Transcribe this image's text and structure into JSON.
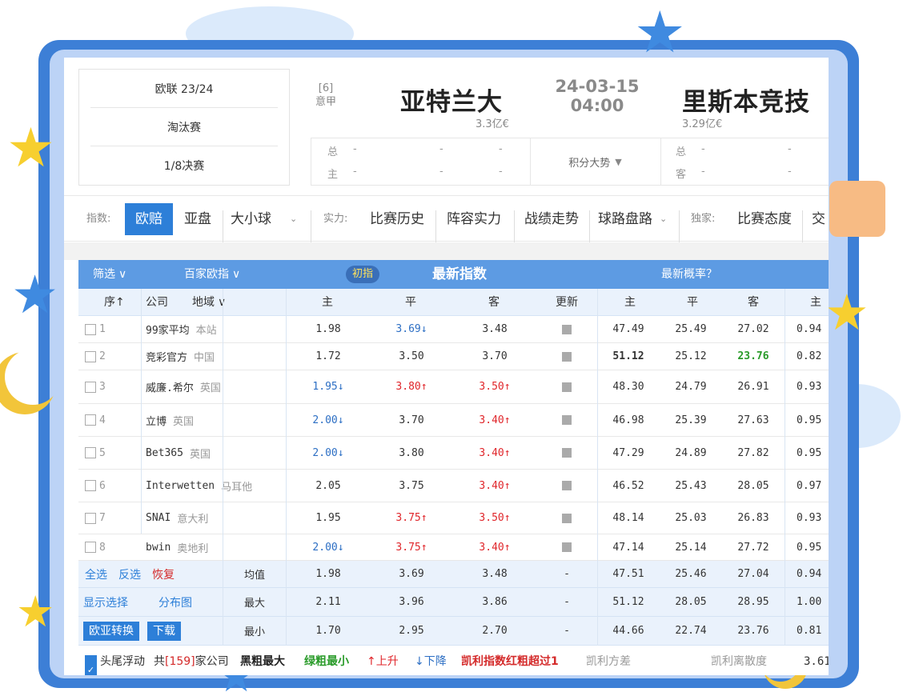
{
  "league": {
    "competition": "欧联 23/24",
    "stage": "淘汰赛",
    "round": "1/8决赛"
  },
  "match": {
    "home": {
      "rank": "[6]",
      "league": "意甲",
      "name": "亚特兰大",
      "value": "3.3亿€"
    },
    "away": {
      "name": "里斯本竞技",
      "value": "3.29亿€"
    },
    "date": "24-03-15",
    "time": "04:00",
    "home_stats": {
      "total_label": "总",
      "home_label": "主",
      "placeholder": "-"
    },
    "away_stats": {
      "total_label": "总",
      "away_label": "客",
      "placeholder": "-"
    },
    "standings_label": "积分大势"
  },
  "tabs": {
    "index_label": "指数:",
    "index_tabs": [
      "欧赔",
      "亚盘",
      "大小球"
    ],
    "strength_label": "实力:",
    "strength_tabs": [
      "比赛历史",
      "阵容实力",
      "战绩走势",
      "球路盘路"
    ],
    "exclusive_label": "独家:",
    "exclusive_tabs": [
      "比赛态度",
      "交"
    ]
  },
  "table": {
    "header": {
      "filter": "筛选",
      "baijia": "百家欧指",
      "initial_badge": "初指",
      "latest_index": "最新指数",
      "latest_prob": "最新概率？"
    },
    "columns": {
      "seq": "序",
      "company": "公司",
      "region": "地域",
      "home": "主",
      "draw": "平",
      "away": "客",
      "update": "更新",
      "p_home": "主",
      "p_draw": "平",
      "p_away": "客",
      "k_home": "主"
    },
    "rows": [
      {
        "idx": "1",
        "company": "99家平均",
        "region": "本站",
        "h": "1.98",
        "d": "3.69↓",
        "a": "3.48",
        "ph": "47.49",
        "pd": "25.49",
        "pa": "27.02",
        "k": "0.94"
      },
      {
        "idx": "2",
        "company": "竞彩官方",
        "region": "中国",
        "h": "1.72",
        "d": "3.50",
        "a": "3.70",
        "ph": "51.12",
        "pd": "25.12",
        "pa": "23.76",
        "k": "0.82"
      },
      {
        "idx": "3",
        "company": "威廉.希尔",
        "region": "英国",
        "h": "1.95↓",
        "d": "3.80↑",
        "a": "3.50↑",
        "ph": "48.30",
        "pd": "24.79",
        "pa": "26.91",
        "k": "0.93"
      },
      {
        "idx": "4",
        "company": "立博",
        "region": "英国",
        "h": "2.00↓",
        "d": "3.70",
        "a": "3.40↑",
        "ph": "46.98",
        "pd": "25.39",
        "pa": "27.63",
        "k": "0.95"
      },
      {
        "idx": "5",
        "company": "Bet365",
        "region": "英国",
        "h": "2.00↓",
        "d": "3.80",
        "a": "3.40↑",
        "ph": "47.29",
        "pd": "24.89",
        "pa": "27.82",
        "k": "0.95"
      },
      {
        "idx": "6",
        "company": "Interwetten",
        "region": "马耳他",
        "h": "2.05",
        "d": "3.75",
        "a": "3.40↑",
        "ph": "46.52",
        "pd": "25.43",
        "pa": "28.05",
        "k": "0.97"
      },
      {
        "idx": "7",
        "company": "SNAI",
        "region": "意大利",
        "h": "1.95",
        "d": "3.75↑",
        "a": "3.50↑",
        "ph": "48.14",
        "pd": "25.03",
        "pa": "26.83",
        "k": "0.93"
      },
      {
        "idx": "8",
        "company": "bwin",
        "region": "奥地利",
        "h": "2.00↓",
        "d": "3.75↑",
        "a": "3.40↑",
        "ph": "47.14",
        "pd": "25.14",
        "pa": "27.72",
        "k": "0.95"
      }
    ],
    "summary": {
      "select_all": "全选",
      "invert": "反选",
      "restore": "恢复",
      "show_selected": "显示选择",
      "distribution": "分布图",
      "convert_btn": "欧亚转换",
      "download_btn": "下载",
      "avg": {
        "label": "均值",
        "h": "1.98",
        "d": "3.69",
        "a": "3.48",
        "u": "-",
        "ph": "47.51",
        "pd": "25.46",
        "pa": "27.04",
        "k": "0.94"
      },
      "max": {
        "label": "最大",
        "h": "2.11",
        "d": "3.96",
        "a": "3.86",
        "u": "-",
        "ph": "51.12",
        "pd": "28.05",
        "pa": "28.95",
        "k": "1.00"
      },
      "min": {
        "label": "最小",
        "h": "1.70",
        "d": "2.95",
        "a": "2.70",
        "u": "-",
        "ph": "44.66",
        "pd": "22.74",
        "pa": "23.76",
        "k": "0.81"
      }
    },
    "footer": {
      "float_label": "头尾浮动",
      "count_prefix": "共",
      "count": "[159]",
      "count_suffix": "家公司",
      "legend_black": "黑粗最大",
      "legend_green": "绿粗最小",
      "legend_up": "↑上升",
      "legend_down": "↓下降",
      "legend_kelly": "凯利指数红粗超过1",
      "trail": "凯利方差",
      "trail2": "凯利离散度",
      "trail_value": "3.61"
    }
  },
  "colors": {
    "accent": "#2d7fd8",
    "header_blue": "#5d9be3",
    "up_red": "#e0262b",
    "down_blue": "#2d6fc4",
    "min_green": "#2a9b2a",
    "frame_blue": "#3d7fd6"
  },
  "icons": [
    "chevron-down-icon",
    "sort-up-icon",
    "checkbox-icon",
    "update-square-icon",
    "star-icon",
    "cloud-icon",
    "moon-icon"
  ]
}
